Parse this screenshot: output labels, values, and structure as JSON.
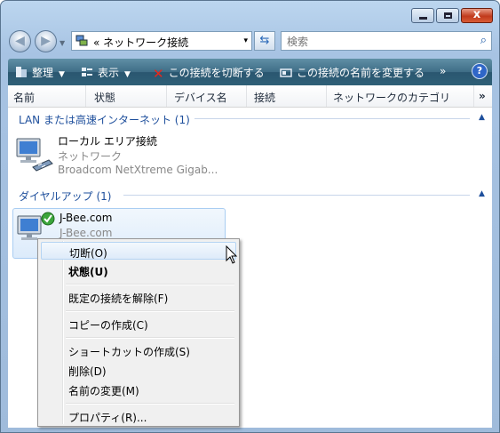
{
  "window": {
    "controls": {
      "close_glyph": "x"
    }
  },
  "address": {
    "prefix": "«",
    "location": "ネットワーク接続",
    "dropdown_glyph": "▾"
  },
  "search": {
    "placeholder": "検索"
  },
  "toolbar": {
    "organize": "整理",
    "view": "表示",
    "disconnect": "この接続を切断する",
    "rename": "この接続の名前を変更する",
    "more": "»",
    "help": "?"
  },
  "columns": [
    "名前",
    "状態",
    "デバイス名",
    "接続",
    "ネットワークのカテゴリ",
    "»"
  ],
  "groups": [
    {
      "title": "LAN または高速インターネット (1)",
      "items": [
        {
          "name": "ローカル エリア接続",
          "line2": "ネットワーク",
          "line3": "Broadcom NetXtreme Gigab..."
        }
      ]
    },
    {
      "title": "ダイヤルアップ (1)",
      "items": [
        {
          "name": "J-Bee.com",
          "line2": "J-Bee.com"
        }
      ]
    }
  ],
  "context_menu": {
    "items": [
      {
        "label": "切断(O)",
        "state": "hover"
      },
      {
        "label": "状態(U)",
        "state": "default"
      },
      {
        "label": "既定の接続を解除(F)"
      },
      {
        "label": "コピーの作成(C)"
      },
      {
        "label": "ショートカットの作成(S)"
      },
      {
        "label": "削除(D)"
      },
      {
        "label": "名前の変更(M)"
      },
      {
        "label": "プロパティ(R)..."
      }
    ]
  },
  "colors": {
    "accent": "#1e4f9c",
    "toolbar": "#2f6077",
    "selection": "#dcebfb"
  }
}
